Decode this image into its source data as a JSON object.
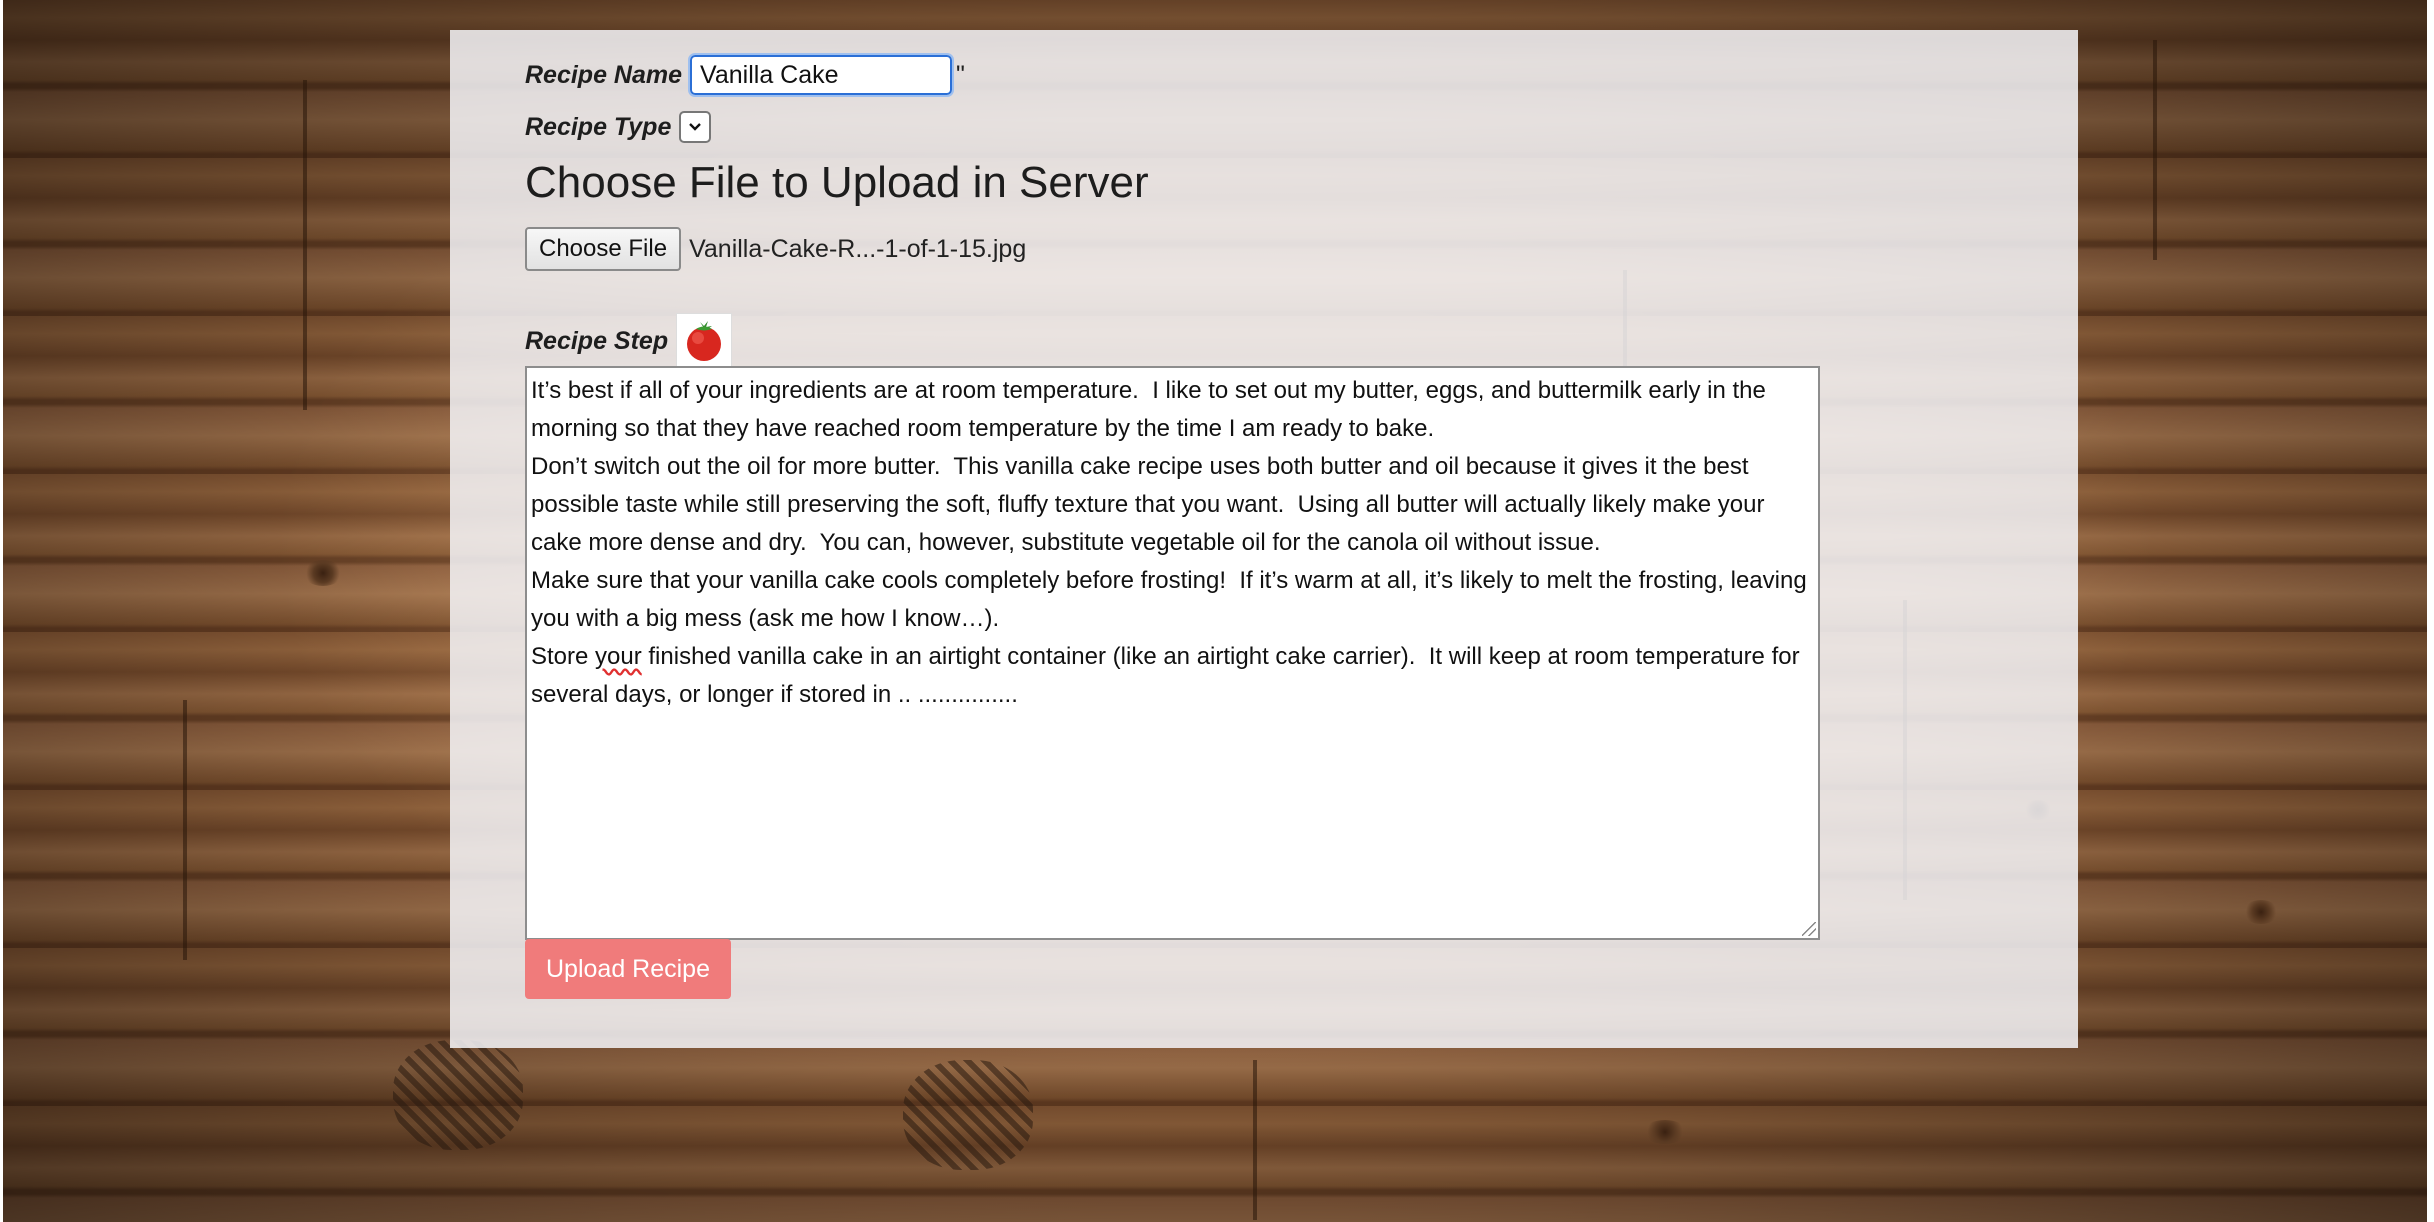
{
  "form": {
    "recipe_name_label": "Recipe Name",
    "recipe_name_value": "Vanilla Cake",
    "stray_char": "\"",
    "recipe_type_label": "Recipe Type",
    "recipe_type_selected": "",
    "upload_heading": "Choose File to Upload in Server",
    "choose_file_label": "Choose File",
    "chosen_file_name": "Vanilla-Cake-R...-1-of-1-15.jpg",
    "recipe_step_label": "Recipe Step",
    "recipe_step_icon": "tomato-icon",
    "recipe_step_text_before_misspelling": "It’s best if all of your ingredients are at room temperature.  I like to set out my butter, eggs, and buttermilk early in the morning so that they have reached room temperature by the time I am ready to bake.\nDon’t switch out the oil for more butter.  This vanilla cake recipe uses both butter and oil because it gives it the best possible taste while still preserving the soft, fluffy texture that you want.  Using all butter will actually likely make your cake more dense and dry.  You can, however, substitute vegetable oil for the canola oil without issue.\nMake sure that your vanilla cake cools completely before frosting!  If it’s warm at all, it’s likely to melt the frosting, leaving you with a big mess (ask me how I know…).\nStore ",
    "recipe_step_misspelled_word": "your",
    "recipe_step_text_after_misspelling": " finished vanilla cake in an airtight container (like an airtight cake carrier).  It will keep at room temperature for several days, or longer if stored in .. ...............",
    "upload_button_label": "Upload Recipe"
  },
  "colors": {
    "upload_button": "#f07b7b",
    "card_background": "rgba(245,245,248,0.86)",
    "input_focus_border": "#2b6fd6"
  }
}
